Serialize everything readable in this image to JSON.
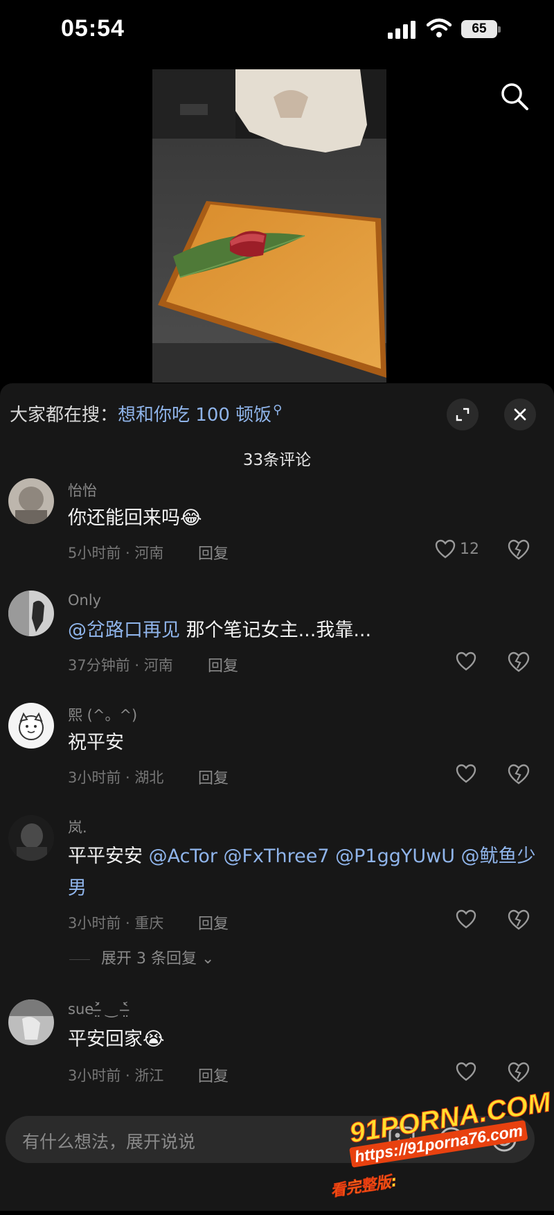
{
  "status_bar": {
    "time": "05:54",
    "battery": "65"
  },
  "hot_search": {
    "prefix": "大家都在搜：",
    "term": "想和你吃 100 顿饭"
  },
  "comments_header": {
    "count_label": "33条评论"
  },
  "comments": [
    {
      "username": "怡怡",
      "text": "你还能回来吗",
      "emoji": "😂",
      "time_location": "5小时前 · 河南",
      "reply_label": "回复",
      "likes": "12"
    },
    {
      "username": "Only",
      "mention": "@岔路口再见",
      "text": " 那个笔记女主...我靠...",
      "time_location": "37分钟前 · 河南",
      "reply_label": "回复",
      "likes": ""
    },
    {
      "username": "熙 (^。^)",
      "text": "祝平安",
      "time_location": "3小时前 · 湖北",
      "reply_label": "回复",
      "likes": ""
    },
    {
      "username": "岚.",
      "text": "平平安安",
      "mention_line1": " @AcTor @FxThree7 @P1ggYUwU @鱿鱼少",
      "mention_line2": "男",
      "time_location": "3小时前 · 重庆",
      "reply_label": "回复",
      "likes": "",
      "expand_label": "展开 3 条回复"
    },
    {
      "username": "sue˃̶̤́ ‿ ˂̶̤̀",
      "text": "平安回家",
      "emoji": "😭",
      "time_location": "3小时前 · 浙江",
      "reply_label": "回复",
      "likes": ""
    }
  ],
  "input": {
    "placeholder": "有什么想法，展开说说"
  },
  "watermark": {
    "brand": "91PORNA.COM",
    "url": "https://91porna76.com",
    "tag": "看完整版:"
  },
  "colors": {
    "mention": "#8fb4ea",
    "sheet_bg": "#171717",
    "input_bg": "#2b2b2b"
  }
}
